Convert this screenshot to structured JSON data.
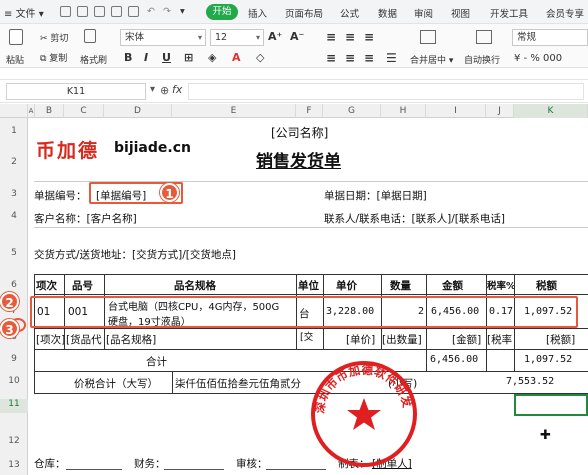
{
  "ribbon": {
    "file_menu": "文件",
    "tabs": [
      "开始",
      "插入",
      "页面布局",
      "公式",
      "数据",
      "审阅",
      "视图",
      "开发工具",
      "会员专享"
    ],
    "active_tab": "开始",
    "clipboard": {
      "paste": "粘贴",
      "cut": "剪切",
      "copy": "复制",
      "format_painter": "格式刷"
    },
    "font_name": "宋体",
    "font_size": "12",
    "merge_center": "合并居中",
    "wrap_text": "自动换行",
    "number_format": "常规",
    "number_symbols": "¥ - % 000"
  },
  "formula_bar": {
    "cell_ref": "K11",
    "fx": "fx",
    "value": ""
  },
  "columns": [
    "A",
    "B",
    "C",
    "D",
    "E",
    "F",
    "G",
    "H",
    "I",
    "J",
    "K"
  ],
  "rows": [
    "1",
    "2",
    "3",
    "4",
    "5",
    "6",
    "7",
    "8",
    "9",
    "10",
    "11",
    "12",
    "13"
  ],
  "logo": {
    "chars": "币加德",
    "domain": "bijiade.cn"
  },
  "sheet": {
    "company": "[公司名称]",
    "doc_title": "销售发货单",
    "doc_no_label": "单据编号：",
    "doc_no_value": "[单据编号]",
    "doc_date": "单据日期：[单据日期]",
    "customer": "客户名称：[客户名称]",
    "contact": "联系人/联系电话：[联系人]/[联系电话]",
    "delivery": "交货方式/送货地址：[交货方式]/[交货地点]",
    "headers": [
      "项次",
      "品号",
      "品名规格",
      "单位",
      "单价",
      "数量",
      "金额",
      "税率%",
      "税额"
    ],
    "item_row": {
      "idx": "01",
      "code": "001",
      "name_line1": "台式电脑（四核CPU，4G内存，500G",
      "name_line2": "硬盘，19寸液晶）",
      "unit": "台",
      "price": "3,228.00",
      "qty": "2",
      "amount": "6,456.00",
      "rate": "0.17",
      "tax": "1,097.52"
    },
    "template_row": {
      "idx": "[项次]",
      "code": "[货品代",
      "name": "[品名规格]",
      "unit": "[交",
      "price": "[单价]",
      "qty": "[出数量]",
      "amount": "[金额]",
      "rate": "[税率",
      "tax": "[税额]"
    },
    "subtotal_label": "合计",
    "subtotal_amount": "6,456.00",
    "subtotal_tax": "1,097.52",
    "grand_label": "价税合计（大写）",
    "grand_text": "柒仟伍佰伍拾叁元伍角贰分",
    "grand_small": "(小写)",
    "grand_value": "7,553.52",
    "footer": {
      "warehouse": "仓库：",
      "finance": "财务：",
      "review": "审核：",
      "maker": "制表：",
      "maker_value": "[制单人]"
    }
  },
  "stamp": {
    "text": "深圳市币加德软件研发有限公司",
    "color": "#e02020"
  },
  "badges": [
    "1",
    "2",
    "3"
  ],
  "accent": "#22a94b",
  "highlight_color": "#e8593c"
}
